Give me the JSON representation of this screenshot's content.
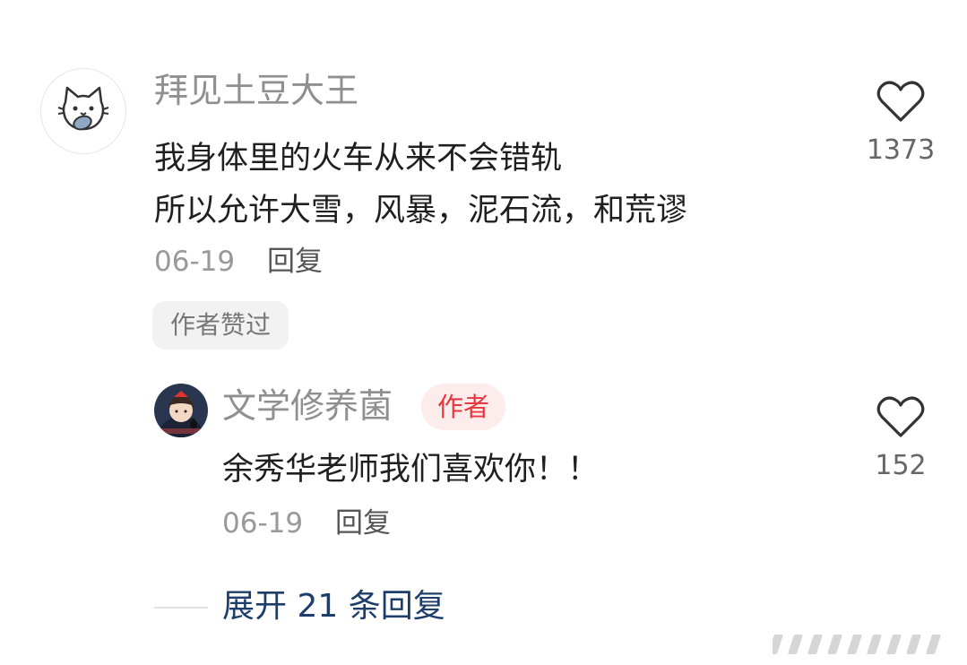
{
  "comment": {
    "username": "拜见土豆大王",
    "text_lines": [
      "我身体里的火车从来不会错轨",
      "所以允许大雪，风暴，泥石流，和荒谬"
    ],
    "date": "06-19",
    "reply_label": "回复",
    "author_liked": "作者赞过",
    "likes": "1373",
    "avatar_icon": "cat-avatar-icon"
  },
  "reply": {
    "username": "文学修养菌",
    "badge": "作者",
    "text": "余秀华老师我们喜欢你！！",
    "date": "06-19",
    "reply_label": "回复",
    "likes": "152",
    "avatar_icon": "girl-avatar-icon"
  },
  "expand": {
    "label": "展开 21 条回复"
  },
  "colors": {
    "author_badge_bg": "#fdecec",
    "author_badge_text": "#e8363f",
    "expand_link": "#1d3e6b"
  }
}
